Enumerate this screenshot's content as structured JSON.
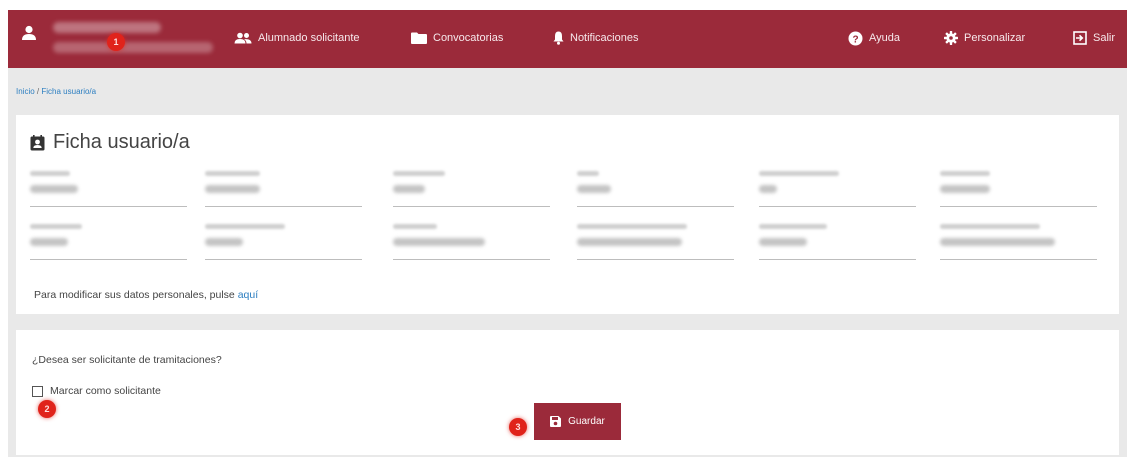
{
  "header": {
    "nav": [
      {
        "label": "Alumnado solicitante",
        "icon": "users-icon"
      },
      {
        "label": "Convocatorias",
        "icon": "folder-icon"
      },
      {
        "label": "Notificaciones",
        "icon": "bell-icon"
      }
    ],
    "right": [
      {
        "label": "Ayuda",
        "icon": "help-icon"
      },
      {
        "label": "Personalizar",
        "icon": "gear-icon"
      },
      {
        "label": "Salir",
        "icon": "exit-icon"
      }
    ]
  },
  "breadcrumb": {
    "home": "Inicio",
    "separator": "/",
    "current": "Ficha usuario/a"
  },
  "profile": {
    "title": "Ficha usuario/a",
    "modify_text": "Para modificar sus datos personales, pulse",
    "modify_link": "aquí"
  },
  "applicant": {
    "question": "¿Desea ser solicitante de tramitaciones?",
    "checkbox_label": "Marcar como solicitante",
    "checked": false,
    "save_label": "Guardar"
  },
  "markers": [
    "1",
    "2",
    "3"
  ],
  "colors": {
    "brand": "#9b2a3a",
    "link": "#2d7fc1",
    "marker": "#e0231b"
  }
}
